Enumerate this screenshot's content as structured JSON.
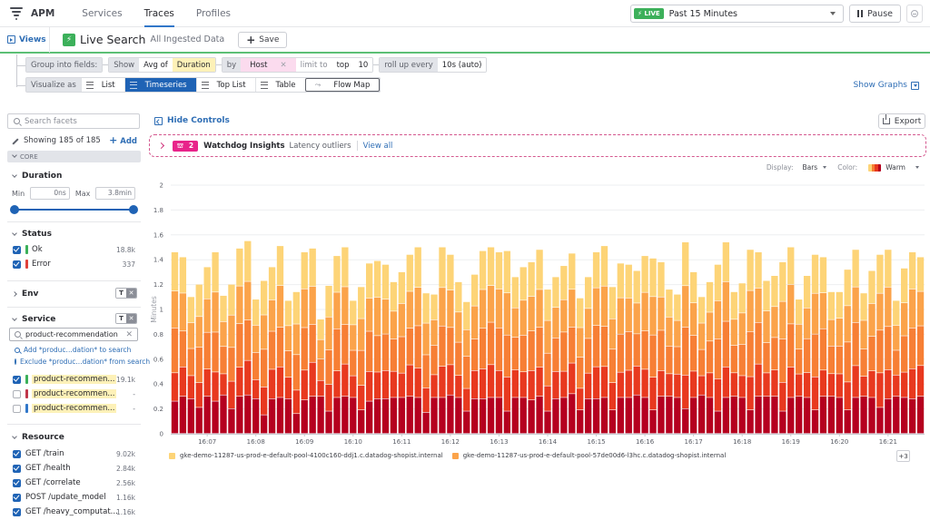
{
  "topnav": {
    "app": "APM",
    "tabs": [
      {
        "label": "Services",
        "active": false
      },
      {
        "label": "Traces",
        "active": true
      },
      {
        "label": "Profiles",
        "active": false
      }
    ],
    "live_badge": "LIVE",
    "time_range": "Past 15 Minutes",
    "pause_label": "Pause"
  },
  "subbar": {
    "views_label": "Views",
    "title": "Live Search",
    "subtitle": "All Ingested Data",
    "save_label": "Save"
  },
  "query": {
    "group_label": "Group into fields:",
    "show_label": "Show",
    "agg": "Avg of",
    "measure": "Duration",
    "by_label": "by",
    "group_by": "Host",
    "limit_label": "limit to",
    "limit_dir": "top",
    "limit_n": "10",
    "rollup_label": "roll up every",
    "rollup_value": "10s (auto)",
    "visualize_label": "Visualize as",
    "viz_options": [
      {
        "label": "List",
        "active": false
      },
      {
        "label": "Timeseries",
        "active": true
      },
      {
        "label": "Top List",
        "active": false
      },
      {
        "label": "Table",
        "active": false
      },
      {
        "label": "Flow Map",
        "active": false
      }
    ],
    "show_graphs": "Show Graphs"
  },
  "sidebar": {
    "search_placeholder": "Search facets",
    "showing": "Showing 185 of 185",
    "add_label": "Add",
    "core_label": "CORE",
    "duration": {
      "title": "Duration",
      "min_label": "Min",
      "min_value": "0ns",
      "max_label": "Max",
      "max_value": "3.8min"
    },
    "status": {
      "title": "Status",
      "items": [
        {
          "label": "Ok",
          "count": "18.8k",
          "checked": true,
          "color": "#3cb05a"
        },
        {
          "label": "Error",
          "count": "337",
          "checked": true,
          "color": "#e0413a"
        }
      ]
    },
    "env": {
      "title": "Env"
    },
    "service": {
      "title": "Service",
      "search_value": "product-recommendation",
      "add_link": "Add *produc...dation* to search",
      "exclude_link": "Exclude *produc...dation* from search",
      "items": [
        {
          "label": "product-recommen...",
          "count": "19.1k",
          "checked": true,
          "color": "#3cb05a"
        },
        {
          "label": "product-recommen...",
          "count": "-",
          "checked": false,
          "color": "#c0364a"
        },
        {
          "label": "product-recommen...",
          "count": "-",
          "checked": false,
          "color": "#3177c9"
        }
      ]
    },
    "resource": {
      "title": "Resource",
      "items": [
        {
          "label": "GET /train",
          "count": "9.02k",
          "checked": true
        },
        {
          "label": "GET /health",
          "count": "2.84k",
          "checked": true
        },
        {
          "label": "GET /correlate",
          "count": "2.56k",
          "checked": true
        },
        {
          "label": "POST /update_model",
          "count": "1.16k",
          "checked": true
        },
        {
          "label": "GET /heavy_computat...",
          "count": "1.16k",
          "checked": true
        }
      ]
    }
  },
  "main": {
    "hide_controls": "Hide Controls",
    "export_label": "Export",
    "watchdog": {
      "count": "2",
      "title": "Watchdog Insights",
      "subtitle": "Latency outliers",
      "link": "View all"
    },
    "display_label": "Display:",
    "display_value": "Bars",
    "color_label": "Color:",
    "color_value": "Warm",
    "legend_more": "+3"
  },
  "chart_data": {
    "type": "bar",
    "stacked": true,
    "title": "",
    "xlabel": "",
    "ylabel": "Minutes",
    "ylim": [
      0,
      2
    ],
    "yticks": [
      0,
      0.2,
      0.4,
      0.6,
      0.8,
      1,
      1.2,
      1.4,
      1.6,
      1.8,
      2
    ],
    "grid": true,
    "xtick_labels": [
      "16:07",
      "16:08",
      "16:09",
      "16:10",
      "16:11",
      "16:12",
      "16:13",
      "16:14",
      "16:15",
      "16:16",
      "16:17",
      "16:18",
      "16:19",
      "16:20",
      "16:21"
    ],
    "xtick_bar_index": [
      4,
      10,
      16,
      22,
      28,
      34,
      40,
      46,
      52,
      58,
      64,
      70,
      76,
      82,
      88
    ],
    "legend_position": "bottom",
    "series_colors": [
      "#b5001f",
      "#e8391f",
      "#f77f35",
      "#fba34a",
      "#fdd477"
    ],
    "legend": [
      {
        "name": "gke-demo-11287-us-prod-e-default-pool-4100c160-ddj1.c.datadog-shopist.internal",
        "color": "#fdd477"
      },
      {
        "name": "gke-demo-11287-us-prod-e-default-pool-57de00d6-l3hc.c.datadog-shopist.internal",
        "color": "#fba34a"
      }
    ],
    "totals": [
      1.46,
      1.42,
      1.1,
      1.2,
      1.34,
      1.46,
      1.11,
      1.2,
      1.49,
      1.55,
      1.08,
      1.23,
      1.34,
      1.51,
      1.07,
      1.14,
      1.46,
      1.49,
      0.92,
      1.19,
      1.43,
      1.5,
      1.07,
      1.18,
      1.37,
      1.39,
      1.36,
      1.22,
      1.3,
      1.44,
      1.5,
      1.13,
      1.12,
      1.5,
      1.44,
      1.22,
      1.06,
      1.28,
      1.47,
      1.5,
      1.46,
      1.47,
      1.26,
      1.34,
      1.38,
      1.48,
      1.16,
      1.26,
      1.35,
      1.45,
      1.09,
      1.26,
      1.46,
      1.51,
      1.18,
      1.37,
      1.36,
      1.31,
      1.43,
      1.41,
      1.38,
      1.16,
      1.12,
      1.54,
      1.3,
      1.1,
      1.22,
      1.36,
      1.54,
      1.14,
      1.21,
      1.48,
      1.46,
      1.23,
      1.27,
      1.38,
      1.5,
      1.08,
      1.27,
      1.44,
      1.42,
      1.14,
      1.14,
      1.32,
      1.48,
      1.13,
      1.31,
      1.44,
      1.48,
      1.07,
      1.33,
      1.46,
      1.42
    ],
    "bottoms": [
      0.26,
      0.3,
      0.28,
      0.21,
      0.3,
      0.26,
      0.31,
      0.2,
      0.3,
      0.31,
      0.28,
      0.15,
      0.28,
      0.29,
      0.28,
      0.16,
      0.27,
      0.3,
      0.3,
      0.18,
      0.29,
      0.3,
      0.29,
      0.19,
      0.26,
      0.28,
      0.28,
      0.29,
      0.29,
      0.3,
      0.29,
      0.17,
      0.29,
      0.29,
      0.31,
      0.29,
      0.18,
      0.28,
      0.28,
      0.29,
      0.29,
      0.18,
      0.29,
      0.29,
      0.27,
      0.3,
      0.18,
      0.28,
      0.29,
      0.32,
      0.19,
      0.28,
      0.28,
      0.29,
      0.19,
      0.29,
      0.29,
      0.31,
      0.29,
      0.19,
      0.3,
      0.3,
      0.29,
      0.2,
      0.29,
      0.31,
      0.29,
      0.18,
      0.29,
      0.3,
      0.29,
      0.19,
      0.3,
      0.3,
      0.3,
      0.18,
      0.29,
      0.3,
      0.29,
      0.19,
      0.3,
      0.3,
      0.29,
      0.19,
      0.29,
      0.3,
      0.29,
      0.21,
      0.28,
      0.3,
      0.29,
      0.28,
      0.3
    ],
    "layer_shares": [
      0.19,
      0.17,
      0.22,
      0.21,
      0.21
    ]
  }
}
